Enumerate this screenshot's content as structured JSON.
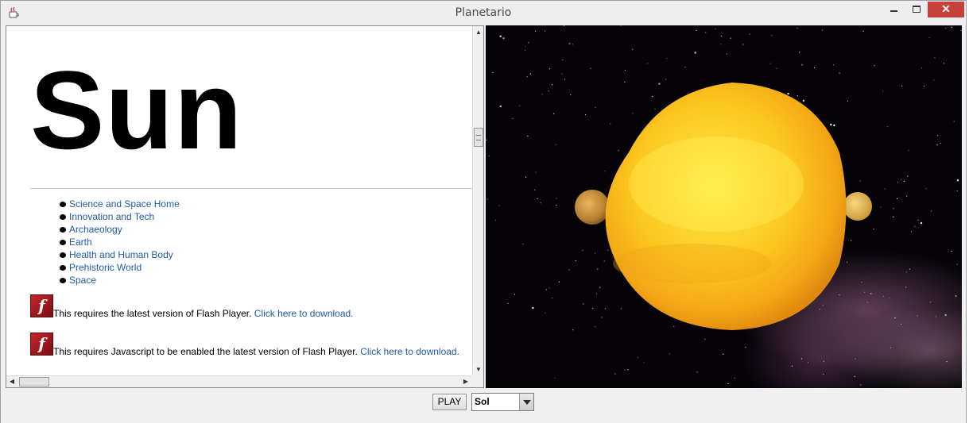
{
  "window": {
    "title": "Planetario",
    "icon": "java-cup-icon"
  },
  "page": {
    "heading": "Sun",
    "nav_links": [
      {
        "label": "Science and Space Home"
      },
      {
        "label": "Innovation and Tech"
      },
      {
        "label": "Archaeology"
      },
      {
        "label": "Earth"
      },
      {
        "label": "Health and Human Body"
      },
      {
        "label": "Prehistoric World"
      },
      {
        "label": "Space"
      }
    ],
    "flash_notices": [
      {
        "text": "This requires the latest version of Flash Player. ",
        "link": "Click here to download."
      },
      {
        "text": "This requires Javascript to be enabled the latest version of Flash Player. ",
        "link": "Click here to download."
      }
    ]
  },
  "controls": {
    "play_label": "PLAY",
    "planet_select": {
      "selected": "Sol"
    }
  },
  "scene": {
    "background": "starfield-milky-way",
    "sun_color": "#f9c61a",
    "planet_color": "#c9923a"
  }
}
